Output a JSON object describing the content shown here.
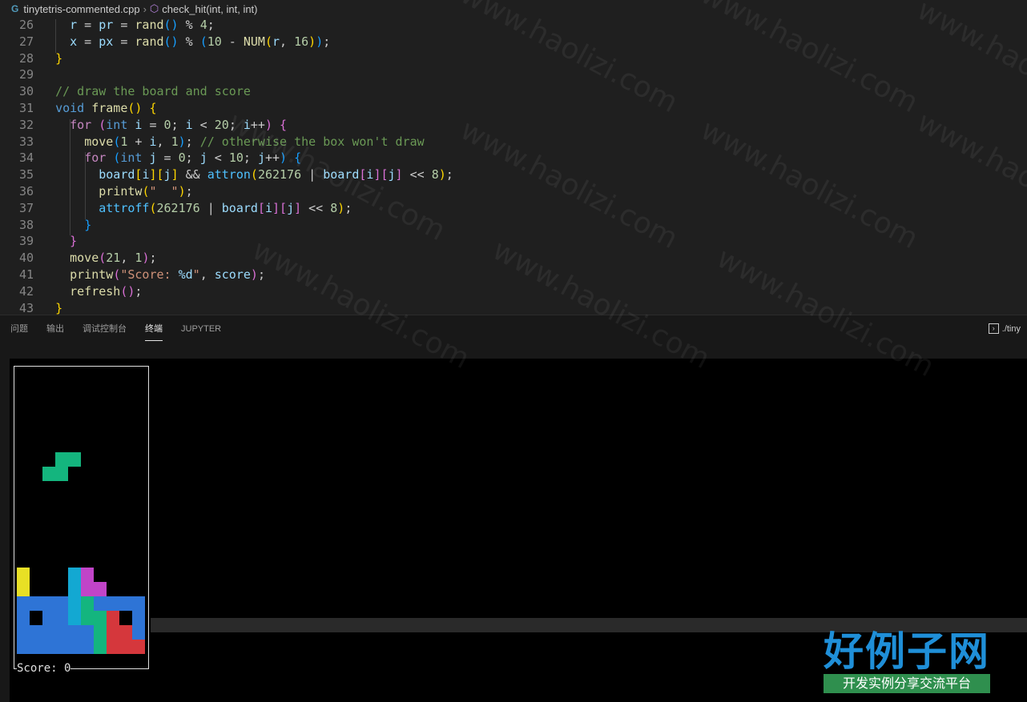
{
  "breadcrumb": {
    "file": "tinytetris-commented.cpp",
    "symbol": "check_hit(int, int, int)"
  },
  "panel": {
    "tabs": [
      "问题",
      "输出",
      "调试控制台",
      "终端",
      "JUPYTER"
    ],
    "active_tab": "终端",
    "terminal_label": "./tiny"
  },
  "terminal": {
    "score_text": "Score: 0"
  },
  "colors": {
    "yellow": "#e8e025",
    "blue": "#2e74d6",
    "cyan": "#13a8d2",
    "magenta": "#c144c8",
    "green": "#14b57e",
    "red": "#d5373c"
  },
  "watermark": {
    "text": "www.haolizi.com",
    "logo_text": "好例子网",
    "logo_sub": "开发实例分享交流平台"
  },
  "code_lines": [
    {
      "n": "26",
      "html": "    <span class=\"var\">r</span> = <span class=\"var\">pr</span> = <span class=\"fn\">rand</span><span class=\"b3\">()</span> % <span class=\"num\">4</span>;"
    },
    {
      "n": "27",
      "html": "    <span class=\"var\">x</span> = <span class=\"var\">px</span> = <span class=\"fn\">rand</span><span class=\"b3\">()</span> % <span class=\"b3\">(</span><span class=\"num\">10</span> - <span class=\"fn\">NUM</span><span class=\"b1\">(</span><span class=\"var\">r</span>, <span class=\"num\">16</span><span class=\"b1\">)</span><span class=\"b3\">)</span>;"
    },
    {
      "n": "28",
      "html": "  <span class=\"b1\">}</span>"
    },
    {
      "n": "29",
      "html": ""
    },
    {
      "n": "30",
      "html": "  <span class=\"cm\">// draw the board and score</span>"
    },
    {
      "n": "31",
      "html": "  <span class=\"kw\">void</span> <span class=\"fn\">frame</span><span class=\"b1\">()</span> <span class=\"b1\">{</span>"
    },
    {
      "n": "32",
      "html": "    <span class=\"ctl\">for</span> <span class=\"b2\">(</span><span class=\"kw\">int</span> <span class=\"var\">i</span> = <span class=\"num\">0</span>; <span class=\"var\">i</span> &lt; <span class=\"num\">20</span>; <span class=\"var\">i</span>++<span class=\"b2\">)</span> <span class=\"b2\">{</span>"
    },
    {
      "n": "33",
      "html": "      <span class=\"fn\">move</span><span class=\"b3\">(</span><span class=\"num\">1</span> + <span class=\"var\">i</span>, <span class=\"num\">1</span><span class=\"b3\">)</span>; <span class=\"cm\">// otherwise the box won't draw</span>"
    },
    {
      "n": "34",
      "html": "      <span class=\"ctl\">for</span> <span class=\"b3\">(</span><span class=\"kw\">int</span> <span class=\"var\">j</span> = <span class=\"num\">0</span>; <span class=\"var\">j</span> &lt; <span class=\"num\">10</span>; <span class=\"var\">j</span>++<span class=\"b3\">)</span> <span class=\"b3\">{</span>"
    },
    {
      "n": "35",
      "html": "        <span class=\"var\">board</span><span class=\"b1\">[</span><span class=\"var\">i</span><span class=\"b1\">]</span><span class=\"b1\">[</span><span class=\"var\">j</span><span class=\"b1\">]</span> &amp;&amp; <span class=\"mac\">attron</span><span class=\"b1\">(</span><span class=\"num\">262176</span> | <span class=\"var\">board</span><span class=\"b2\">[</span><span class=\"var\">i</span><span class=\"b2\">]</span><span class=\"b2\">[</span><span class=\"var\">j</span><span class=\"b2\">]</span> &lt;&lt; <span class=\"num\">8</span><span class=\"b1\">)</span>;"
    },
    {
      "n": "36",
      "html": "        <span class=\"fn\">printw</span><span class=\"b1\">(</span><span class=\"str\">\"  \"</span><span class=\"b1\">)</span>;"
    },
    {
      "n": "37",
      "html": "        <span class=\"mac\">attroff</span><span class=\"b1\">(</span><span class=\"num\">262176</span> | <span class=\"var\">board</span><span class=\"b2\">[</span><span class=\"var\">i</span><span class=\"b2\">]</span><span class=\"b2\">[</span><span class=\"var\">j</span><span class=\"b2\">]</span> &lt;&lt; <span class=\"num\">8</span><span class=\"b1\">)</span>;"
    },
    {
      "n": "38",
      "html": "      <span class=\"b3\">}</span>"
    },
    {
      "n": "39",
      "html": "    <span class=\"b2\">}</span>"
    },
    {
      "n": "40",
      "html": "    <span class=\"fn\">move</span><span class=\"b2\">(</span><span class=\"num\">21</span>, <span class=\"num\">1</span><span class=\"b2\">)</span>;"
    },
    {
      "n": "41",
      "html": "    <span class=\"fn\">printw</span><span class=\"b2\">(</span><span class=\"str\">\"Score: </span><span class=\"var\">%d</span><span class=\"str\">\"</span>, <span class=\"var\">score</span><span class=\"b2\">)</span>;"
    },
    {
      "n": "42",
      "html": "    <span class=\"fn\">refresh</span><span class=\"b2\">()</span>;"
    },
    {
      "n": "43",
      "html": "  <span class=\"b1\">}</span>"
    }
  ],
  "board_grid": [
    "..........",
    "..........",
    "..........",
    "..........",
    "..........",
    "..........",
    "...GG.....",
    "..GG......",
    "..........",
    "..........",
    "..........",
    "..........",
    "..........",
    "..........",
    "Y...CM....",
    "Y...CMM...",
    "BBBBCGBBBB",
    "B.BBCGGR.B",
    "BBBBBBGRRB",
    "BBBBBBGRRR"
  ]
}
